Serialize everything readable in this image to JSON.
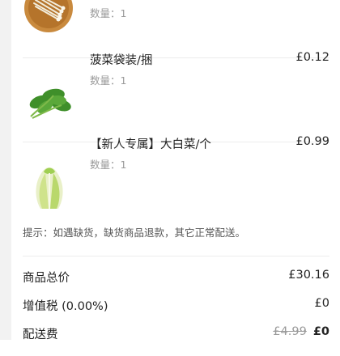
{
  "items": [
    {
      "name": "",
      "qty_label": "数量：1",
      "price": "",
      "icon": "enoki-mushroom-bowl"
    },
    {
      "name": "菠菜袋装/捆",
      "qty_label": "数量：1",
      "price": "£0.12",
      "icon": "spinach"
    },
    {
      "name": "【新人专属】大白菜/个",
      "qty_label": "数量：1",
      "price": "£0.99",
      "icon": "napa-cabbage"
    }
  ],
  "tip": "提示：如遇缺货，缺货商品退款，其它正常配送。",
  "summary": {
    "subtotal_label": "商品总价",
    "subtotal_value": "£30.16",
    "vat_label": "增值税 (0.00%)",
    "vat_value": "£0",
    "delivery_label": "配送费",
    "delivery_original": "£4.99",
    "delivery_value": "£0"
  },
  "colors": {
    "background": "#f2f2f2",
    "card": "#ffffff",
    "text": "#222222",
    "muted": "#9a9a9a",
    "divider": "#ececec"
  }
}
